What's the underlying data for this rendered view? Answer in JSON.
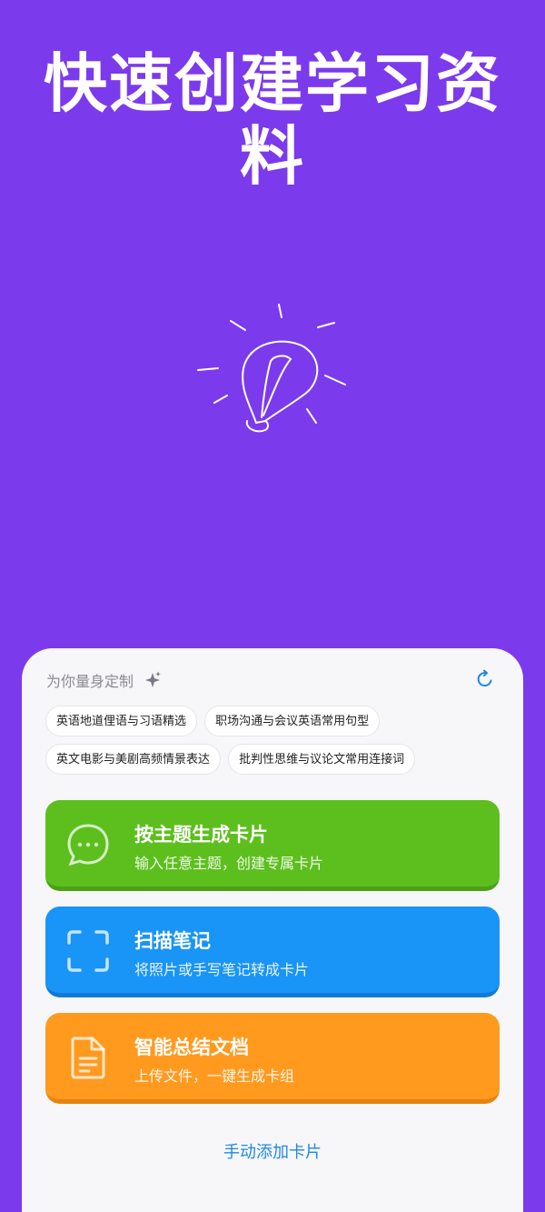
{
  "hero": {
    "headline": "快速创建学习资料"
  },
  "sheet": {
    "title": "为你量身定制",
    "chips": [
      "英语地道俚语与习语精选",
      "职场沟通与会议英语常用句型",
      "英文电影与美剧高频情景表达",
      "批判性思维与议论文常用连接词"
    ],
    "actions": [
      {
        "title": "按主题生成卡片",
        "subtitle": "输入任意主题，创建专属卡片",
        "icon": "chat-bubble-icon",
        "color": "#5DBF1E"
      },
      {
        "title": "扫描笔记",
        "subtitle": "将照片或手写笔记转成卡片",
        "icon": "scan-frame-icon",
        "color": "#1994F7"
      },
      {
        "title": "智能总结文档",
        "subtitle": "上传文件，一键生成卡组",
        "icon": "document-icon",
        "color": "#FF9A1F"
      }
    ],
    "manual_link": "手动添加卡片"
  },
  "colors": {
    "background": "#7C3AED",
    "sheet": "#F7F7F9",
    "link": "#1E88E5"
  }
}
